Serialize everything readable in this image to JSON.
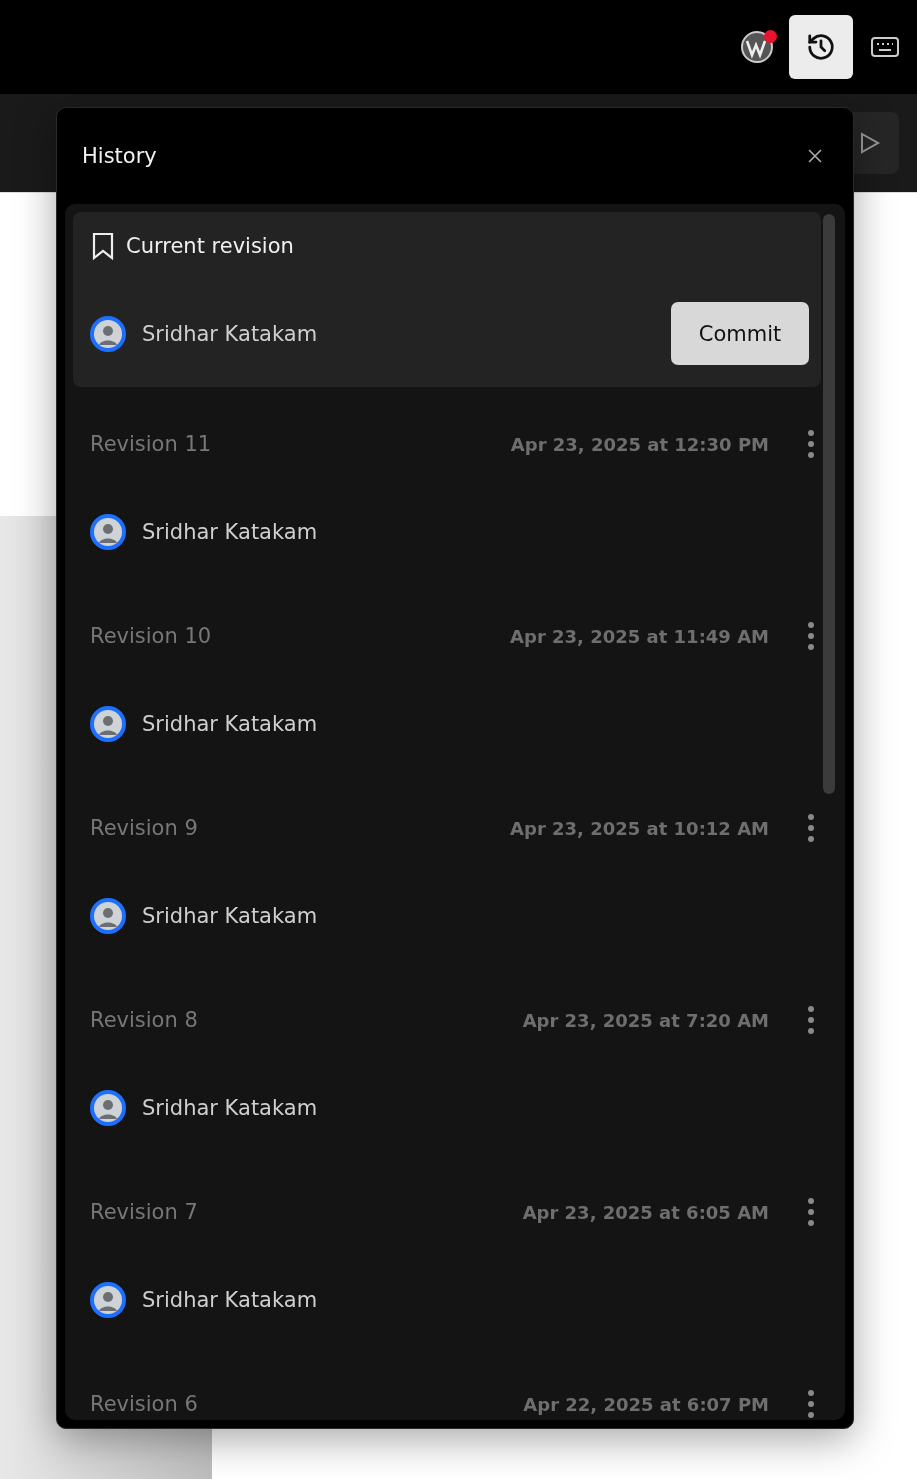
{
  "top_bar": {
    "notification": true,
    "history_button": {
      "selected": true
    }
  },
  "history": {
    "title": "History",
    "current": {
      "label": "Current revision",
      "author": "Sridhar Katakam",
      "button": "Commit"
    },
    "revisions": [
      {
        "title": "Revision 11",
        "date": "Apr 23, 2025 at 12:30 PM",
        "author": "Sridhar Katakam"
      },
      {
        "title": "Revision 10",
        "date": "Apr 23, 2025 at 11:49 AM",
        "author": "Sridhar Katakam"
      },
      {
        "title": "Revision 9",
        "date": "Apr 23, 2025 at 10:12 AM",
        "author": "Sridhar Katakam"
      },
      {
        "title": "Revision 8",
        "date": "Apr 23, 2025 at 7:20 AM",
        "author": "Sridhar Katakam"
      },
      {
        "title": "Revision 7",
        "date": "Apr 23, 2025 at 6:05 AM",
        "author": "Sridhar Katakam"
      },
      {
        "title": "Revision 6",
        "date": "Apr 22, 2025 at 6:07 PM"
      }
    ]
  }
}
